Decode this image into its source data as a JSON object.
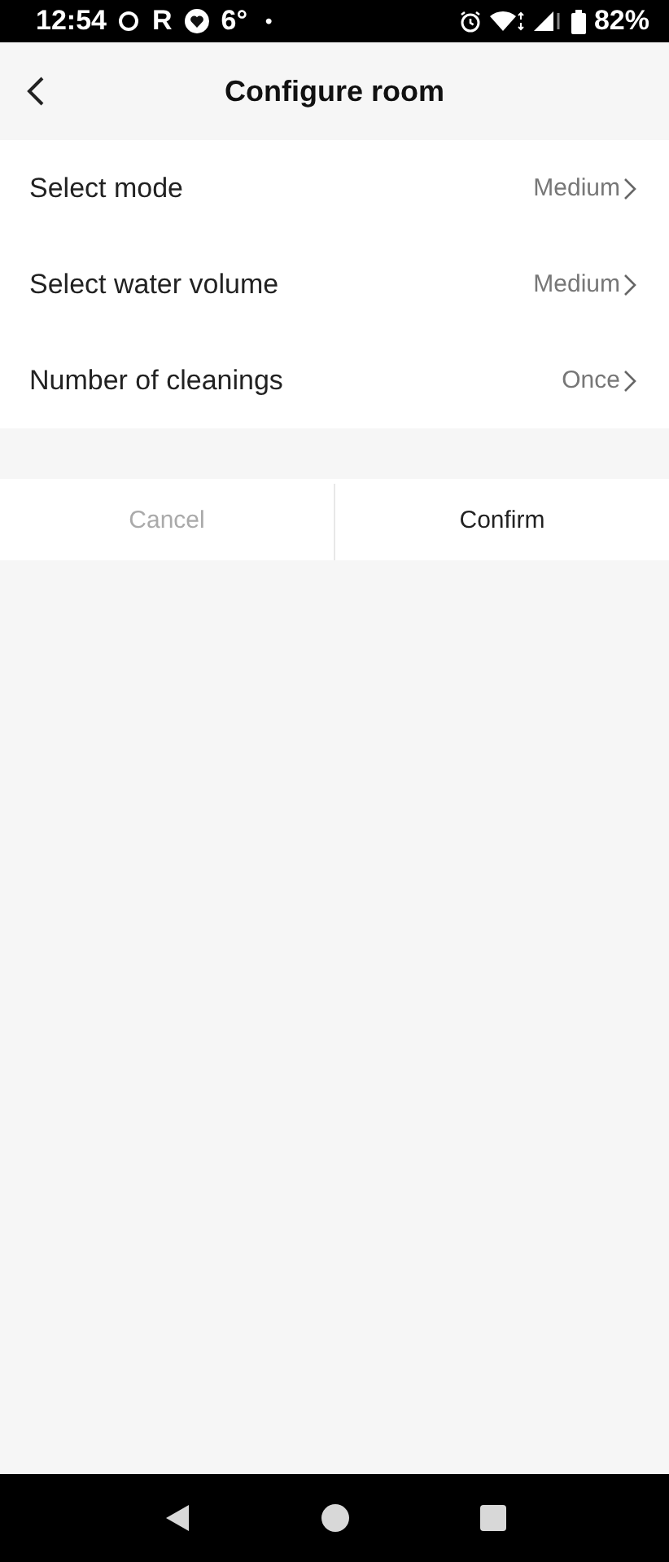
{
  "status_bar": {
    "time": "12:54",
    "carrier_letter": "R",
    "temperature": "6°",
    "dot": "•",
    "battery": "82%"
  },
  "header": {
    "title": "Configure room"
  },
  "settings": [
    {
      "label": "Select mode",
      "value": "Medium"
    },
    {
      "label": "Select water volume",
      "value": "Medium"
    },
    {
      "label": "Number of cleanings",
      "value": "Once"
    }
  ],
  "buttons": [
    {
      "label": "Cancel",
      "disabled": true
    },
    {
      "label": "Confirm",
      "disabled": false
    }
  ]
}
